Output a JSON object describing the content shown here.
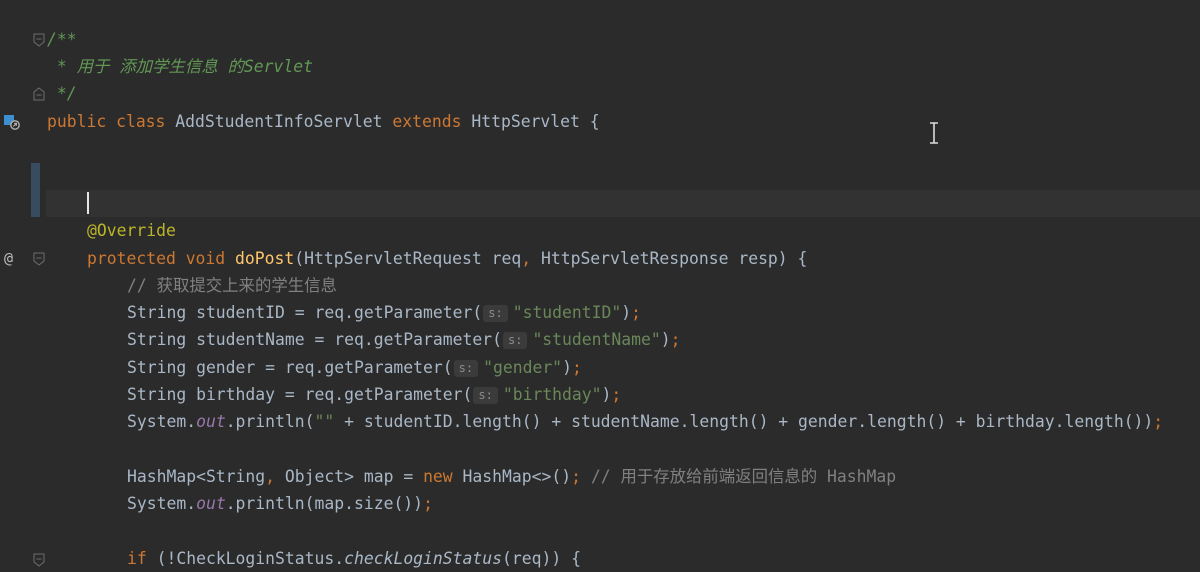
{
  "editor": {
    "lines": [
      {
        "id": "doc-open",
        "segments": [
          {
            "t": "/**",
            "c": "doc"
          }
        ]
      },
      {
        "id": "doc-body",
        "segments": [
          {
            "t": " * 用于 添加学生信息 的Servlet",
            "c": "doc"
          }
        ]
      },
      {
        "id": "doc-close",
        "segments": [
          {
            "t": " */",
            "c": "doc"
          }
        ]
      },
      {
        "id": "class-decl",
        "segments": [
          {
            "t": "public ",
            "c": "kw"
          },
          {
            "t": "class ",
            "c": "kw"
          },
          {
            "t": "AddStudentInfoServlet ",
            "c": ""
          },
          {
            "t": "extends ",
            "c": "kw"
          },
          {
            "t": "HttpServlet {",
            "c": ""
          }
        ]
      },
      {
        "id": "blank-1",
        "segments": []
      },
      {
        "id": "blank-2",
        "segments": []
      },
      {
        "id": "annotation",
        "segments": [
          {
            "t": "@Override",
            "c": "ann"
          }
        ]
      },
      {
        "id": "method-decl",
        "segments": [
          {
            "t": "protected ",
            "c": "kw"
          },
          {
            "t": "void ",
            "c": "kw"
          },
          {
            "t": "doPost",
            "c": "fn"
          },
          {
            "t": "(HttpServletRequest req",
            "c": ""
          },
          {
            "t": ", ",
            "c": "kw"
          },
          {
            "t": "HttpServletResponse resp) {",
            "c": ""
          }
        ]
      },
      {
        "id": "comment-get",
        "segments": [
          {
            "t": "// 获取提交上来的学生信息",
            "c": "cmt"
          }
        ]
      },
      {
        "id": "line-studentID",
        "segments": [
          {
            "t": "String studentID = req.getParameter(",
            "c": ""
          },
          {
            "t": "s:",
            "c": "hint"
          },
          {
            "t": "\"studentID\"",
            "c": "str"
          },
          {
            "t": ")",
            "c": ""
          },
          {
            "t": ";",
            "c": "kw"
          }
        ]
      },
      {
        "id": "line-studentName",
        "segments": [
          {
            "t": "String studentName = req.getParameter(",
            "c": ""
          },
          {
            "t": "s:",
            "c": "hint"
          },
          {
            "t": "\"studentName\"",
            "c": "str"
          },
          {
            "t": ")",
            "c": ""
          },
          {
            "t": ";",
            "c": "kw"
          }
        ]
      },
      {
        "id": "line-gender",
        "segments": [
          {
            "t": "String gender = req.getParameter(",
            "c": ""
          },
          {
            "t": "s:",
            "c": "hint"
          },
          {
            "t": "\"gender\"",
            "c": "str"
          },
          {
            "t": ")",
            "c": ""
          },
          {
            "t": ";",
            "c": "kw"
          }
        ]
      },
      {
        "id": "line-birthday",
        "segments": [
          {
            "t": "String birthday = req.getParameter(",
            "c": ""
          },
          {
            "t": "s:",
            "c": "hint"
          },
          {
            "t": "\"birthday\"",
            "c": "str"
          },
          {
            "t": ")",
            "c": ""
          },
          {
            "t": ";",
            "c": "kw"
          }
        ]
      },
      {
        "id": "line-println-1",
        "segments": [
          {
            "t": "System.",
            "c": ""
          },
          {
            "t": "out",
            "c": "sfield"
          },
          {
            "t": ".println(",
            "c": ""
          },
          {
            "t": "\"\"",
            "c": "str"
          },
          {
            "t": " + studentID.length() + studentName.length() + gender.length() + birthday.length())",
            "c": ""
          },
          {
            "t": ";",
            "c": "kw"
          }
        ]
      },
      {
        "id": "blank-3",
        "segments": []
      },
      {
        "id": "line-hashmap",
        "segments": [
          {
            "t": "HashMap<String",
            "c": ""
          },
          {
            "t": ", ",
            "c": "kw"
          },
          {
            "t": "Object> map = ",
            "c": ""
          },
          {
            "t": "new ",
            "c": "kw"
          },
          {
            "t": "HashMap<>()",
            "c": ""
          },
          {
            "t": "; ",
            "c": "kw"
          },
          {
            "t": "// 用于存放给前端返回信息的 HashMap",
            "c": "cmt"
          }
        ]
      },
      {
        "id": "line-println-2",
        "segments": [
          {
            "t": "System.",
            "c": ""
          },
          {
            "t": "out",
            "c": "sfield"
          },
          {
            "t": ".println(map.size())",
            "c": ""
          },
          {
            "t": ";",
            "c": "kw"
          }
        ]
      },
      {
        "id": "blank-4",
        "segments": []
      },
      {
        "id": "line-if",
        "segments": [
          {
            "t": "if ",
            "c": "kw"
          },
          {
            "t": "(!CheckLoginStatus.",
            "c": ""
          },
          {
            "t": "checkLoginStatus",
            "c": "sm"
          },
          {
            "t": "(req)) {",
            "c": ""
          }
        ]
      }
    ]
  },
  "gutter": {
    "implemented_icon": "implemented-method-icon",
    "override_icon": "@",
    "fold_icon": "fold-icon"
  },
  "colors": {
    "background": "#2b2b2b",
    "current_line": "#323232",
    "keyword": "#cc7832",
    "string": "#6a8759",
    "comment": "#808080",
    "doc_comment": "#629755",
    "annotation": "#bbb529",
    "method": "#ffc66d",
    "static_field": "#9876aa"
  }
}
